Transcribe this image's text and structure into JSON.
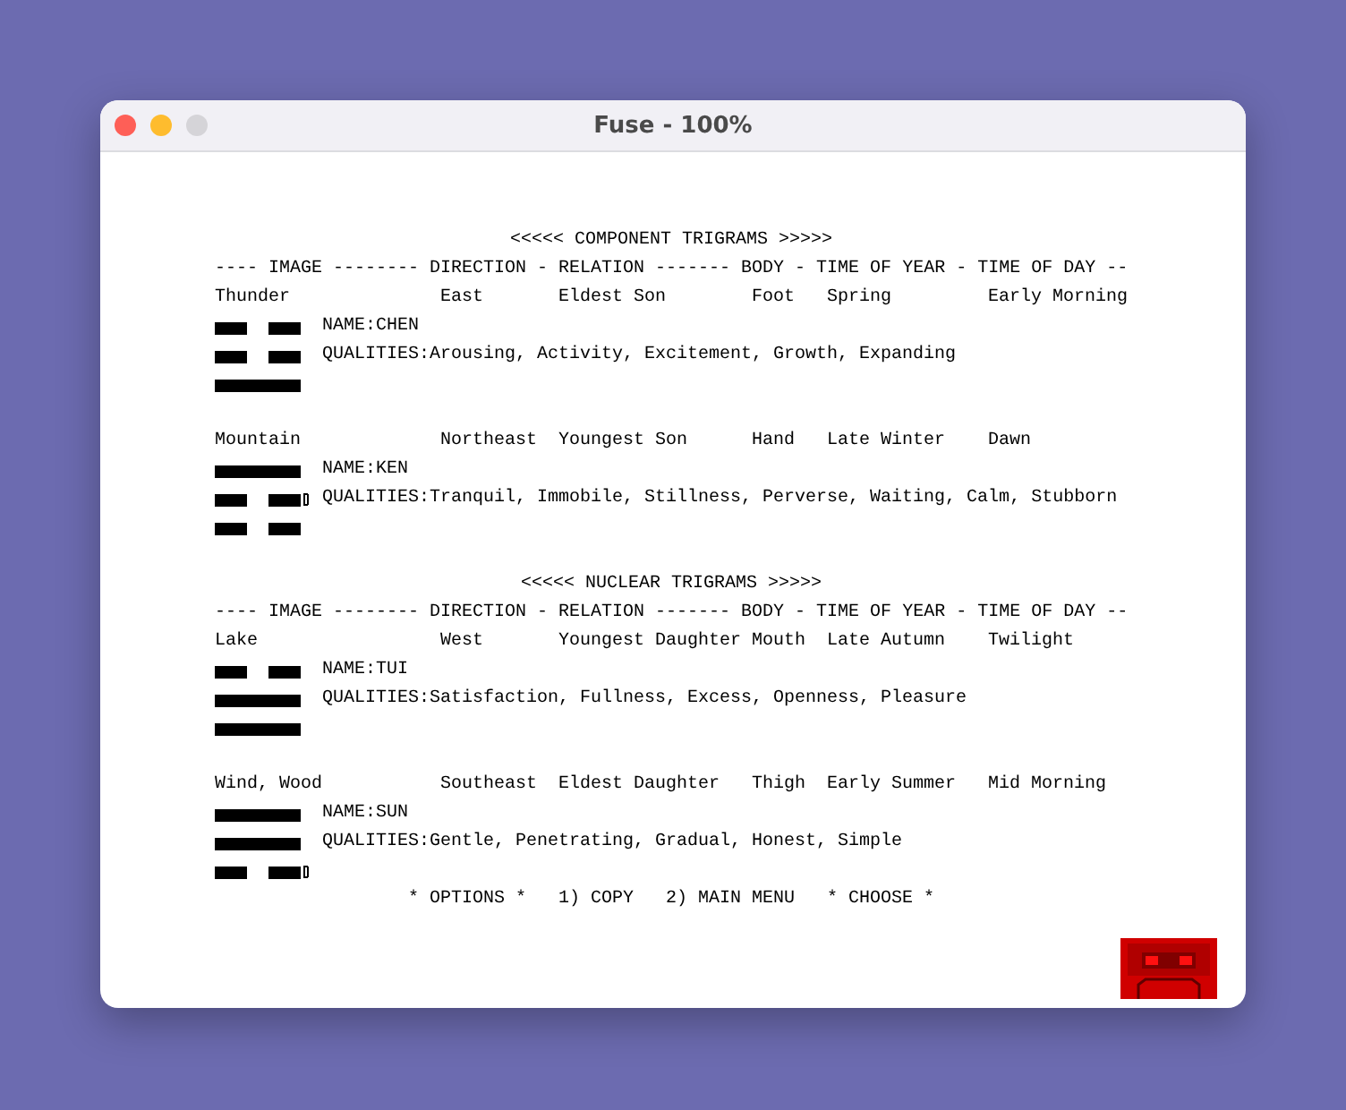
{
  "window": {
    "title": "Fuse - 100%"
  },
  "sections": [
    {
      "title": "<<<<< COMPONENT TRIGRAMS >>>>>",
      "header": "---- IMAGE -------- DIRECTION - RELATION ------- BODY - TIME OF YEAR - TIME OF DAY --",
      "trigrams": [
        {
          "image": "Thunder",
          "direction": "East",
          "relation": "Eldest Son",
          "body": "Foot",
          "time_of_year": "Spring",
          "time_of_day": "Early Morning",
          "name": "NAME:CHEN",
          "qualities": "QUALITIES:Arousing, Activity, Excitement, Growth, Expanding",
          "lines": [
            {
              "kind": "broken",
              "cursor": false
            },
            {
              "kind": "broken",
              "cursor": false
            },
            {
              "kind": "solid",
              "cursor": false
            }
          ]
        },
        {
          "image": "Mountain",
          "direction": "Northeast",
          "relation": "Youngest Son",
          "body": "Hand",
          "time_of_year": "Late Winter",
          "time_of_day": "Dawn",
          "name": "NAME:KEN",
          "qualities": "QUALITIES:Tranquil, Immobile, Stillness, Perverse, Waiting, Calm, Stubborn",
          "lines": [
            {
              "kind": "solid",
              "cursor": false
            },
            {
              "kind": "broken",
              "cursor": true
            },
            {
              "kind": "broken",
              "cursor": false
            }
          ]
        }
      ]
    },
    {
      "title": "<<<<< NUCLEAR TRIGRAMS >>>>>",
      "header": "---- IMAGE -------- DIRECTION - RELATION ------- BODY - TIME OF YEAR - TIME OF DAY --",
      "trigrams": [
        {
          "image": "Lake",
          "direction": "West",
          "relation": "Youngest Daughter",
          "body": "Mouth",
          "time_of_year": "Late Autumn",
          "time_of_day": "Twilight",
          "name": "NAME:TUI",
          "qualities": "QUALITIES:Satisfaction, Fullness, Excess, Openness, Pleasure",
          "lines": [
            {
              "kind": "broken",
              "cursor": false
            },
            {
              "kind": "solid",
              "cursor": false
            },
            {
              "kind": "solid",
              "cursor": false
            }
          ]
        },
        {
          "image": "Wind, Wood",
          "direction": "Southeast",
          "relation": "Eldest Daughter",
          "body": "Thigh",
          "time_of_year": "Early Summer",
          "time_of_day": "Mid Morning",
          "name": "NAME:SUN",
          "qualities": "QUALITIES:Gentle, Penetrating, Gradual, Honest, Simple",
          "lines": [
            {
              "kind": "solid",
              "cursor": false
            },
            {
              "kind": "solid",
              "cursor": false
            },
            {
              "kind": "broken",
              "cursor": true
            }
          ]
        }
      ]
    }
  ],
  "options": [
    "* OPTIONS *",
    "1) COPY",
    "2) MAIN MENU",
    "* CHOOSE *"
  ]
}
